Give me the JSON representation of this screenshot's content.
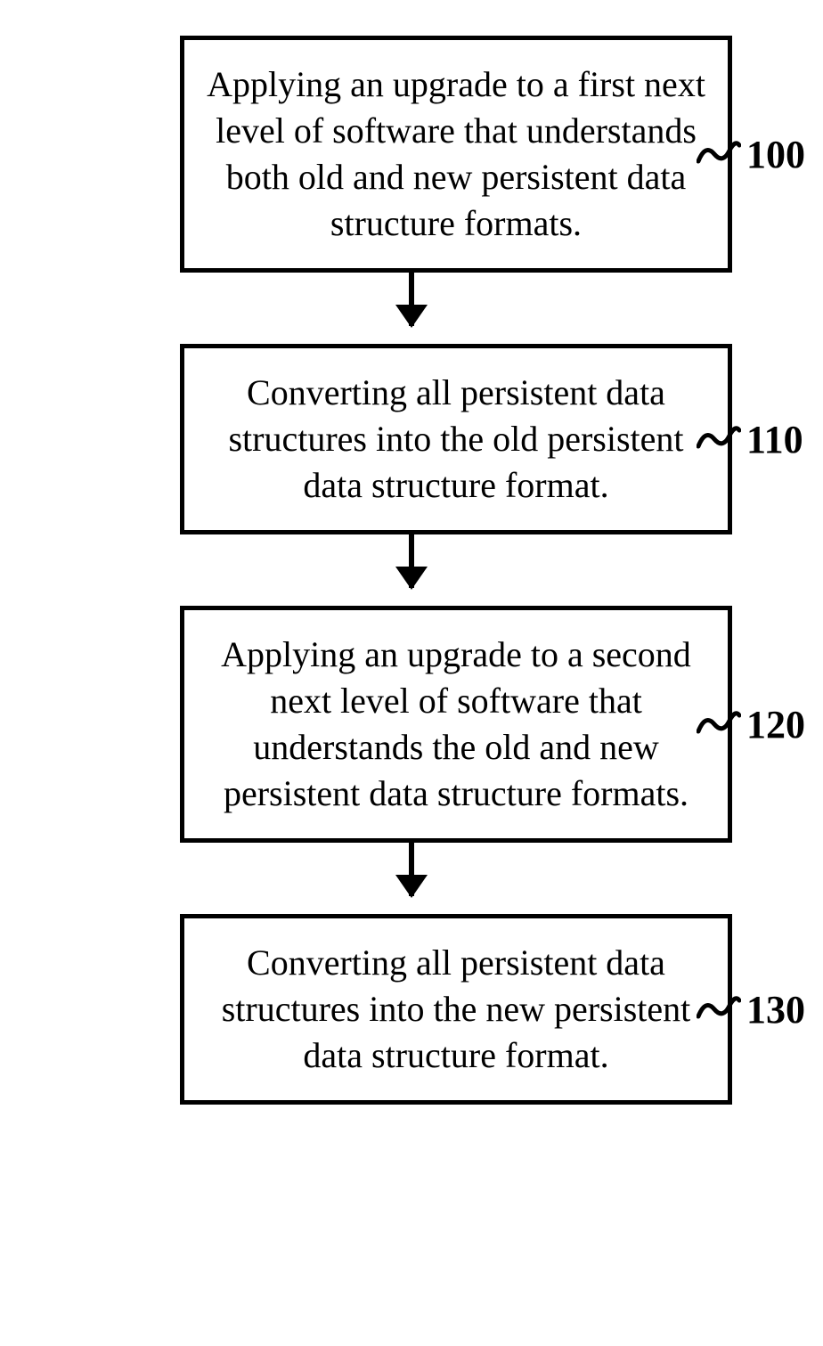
{
  "flowchart": {
    "steps": [
      {
        "text": "Applying an upgrade to a first next level of software that understands both old and new persistent data structure formats.",
        "label": "100"
      },
      {
        "text": "Converting all persistent data structures into the old persistent data structure format.",
        "label": "110"
      },
      {
        "text": "Applying an upgrade to a second next level of software that understands the old and new persistent data structure formats.",
        "label": "120"
      },
      {
        "text": "Converting all persistent data structures into the new persistent data structure format.",
        "label": "130"
      }
    ]
  }
}
